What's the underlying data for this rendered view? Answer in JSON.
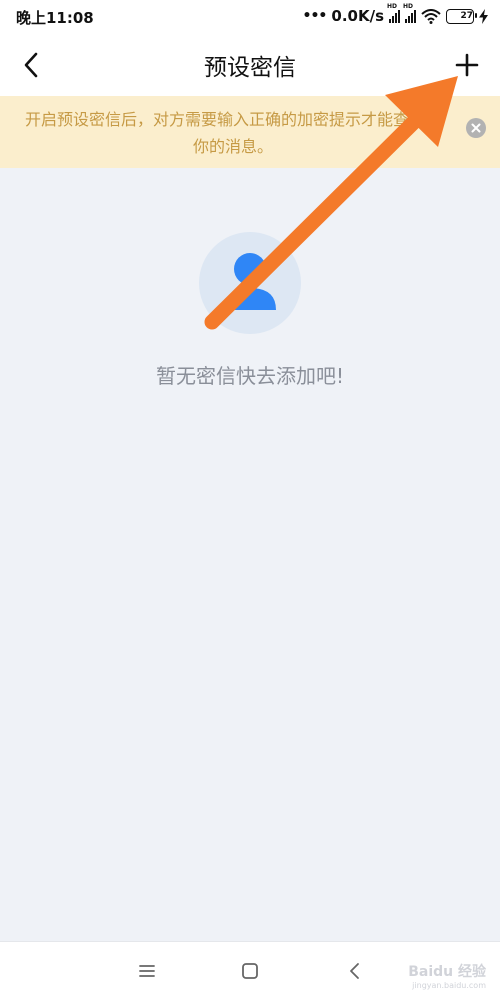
{
  "status_bar": {
    "time": "晚上11:08",
    "network_speed": "0.0K/s",
    "battery_level": "27"
  },
  "header": {
    "title": "预设密信",
    "back_icon": "chevron-left-icon",
    "add_icon": "plus-icon"
  },
  "notice": {
    "text": "开启预设密信后，对方需要输入正确的加密提示才能查看到你的消息。",
    "background_color": "#fbeecd",
    "text_color": "#c69a45"
  },
  "empty_state": {
    "icon": "person-icon",
    "message": "暂无密信快去添加吧!"
  },
  "annotation": {
    "type": "arrow",
    "color": "#f47a2a"
  },
  "system_nav": {
    "buttons": [
      "menu-icon",
      "home-icon",
      "back-icon"
    ]
  },
  "watermark": {
    "text": "Baidu 经验",
    "subtext": "jingyan.baidu.com"
  },
  "colors": {
    "accent_blue": "#2f86f6",
    "background": "#eff2f7"
  }
}
